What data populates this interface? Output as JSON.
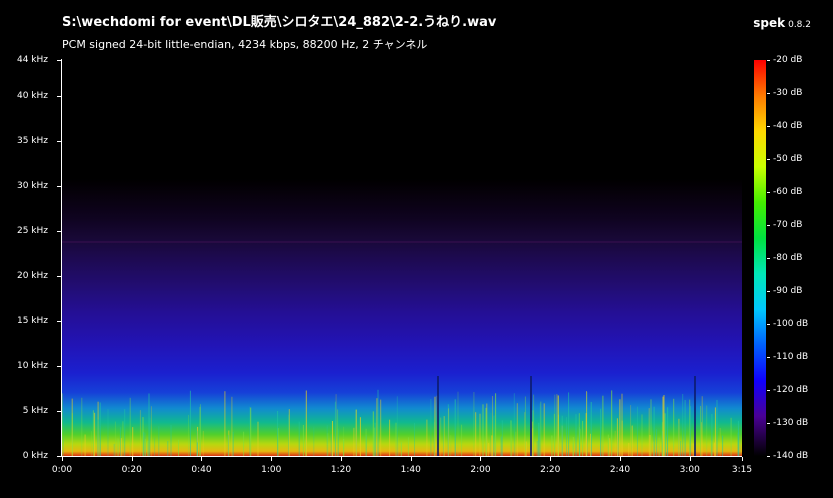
{
  "window": {
    "file_title": "S:\\wechdomi for event\\DL販売\\シロタエ\\24_882\\2-2.うねり.wav",
    "stream_info": "PCM signed 24-bit little-endian, 4234 kbps, 88200 Hz, 2 チャンネル"
  },
  "app": {
    "name": "spek",
    "version": "0.8.2"
  },
  "y_axis": {
    "labels": [
      "44 kHz",
      "40 kHz",
      "35 kHz",
      "30 kHz",
      "25 kHz",
      "20 kHz",
      "15 kHz",
      "10 kHz",
      "5 kHz",
      "0 kHz"
    ],
    "values_khz": [
      44,
      40,
      35,
      30,
      25,
      20,
      15,
      10,
      5,
      0
    ],
    "range_khz": [
      0,
      44
    ]
  },
  "x_axis": {
    "labels": [
      "0:00",
      "0:20",
      "0:40",
      "1:00",
      "1:20",
      "1:40",
      "2:00",
      "2:20",
      "2:40",
      "3:00",
      "3:15"
    ],
    "values_sec": [
      0,
      20,
      40,
      60,
      80,
      100,
      120,
      140,
      160,
      180,
      195
    ],
    "range_sec": [
      0,
      195
    ]
  },
  "color_scale": {
    "labels": [
      "-20 dB",
      "-30 dB",
      "-40 dB",
      "-50 dB",
      "-60 dB",
      "-70 dB",
      "-80 dB",
      "-90 dB",
      "-100 dB",
      "-110 dB",
      "-120 dB",
      "-130 dB",
      "-140 dB"
    ],
    "values_db": [
      -20,
      -30,
      -40,
      -50,
      -60,
      -70,
      -80,
      -90,
      -100,
      -110,
      -120,
      -130,
      -140
    ],
    "range_db": [
      -140,
      -20
    ]
  },
  "colors": {
    "background": "#000000",
    "text": "#ffffff"
  }
}
